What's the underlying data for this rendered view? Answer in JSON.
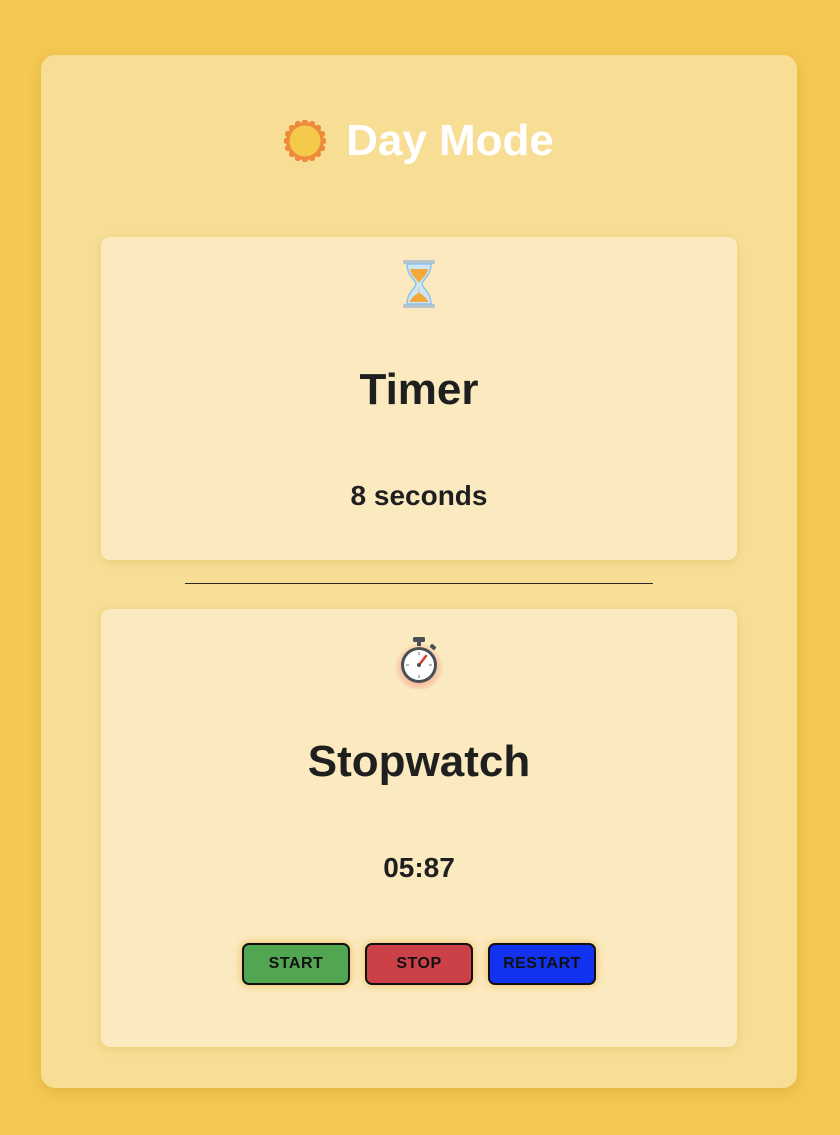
{
  "header": {
    "icon": "sun-icon",
    "title": "Day Mode"
  },
  "timer": {
    "icon": "hourglass-icon",
    "title": "Timer",
    "value": "8 seconds"
  },
  "stopwatch": {
    "icon": "stopwatch-icon",
    "title": "Stopwatch",
    "value": "05:87",
    "buttons": {
      "start": "START",
      "stop": "STOP",
      "restart": "RESTART"
    }
  },
  "colors": {
    "page_background": "#f4c853",
    "card_background": "#f7de94",
    "panel_background": "#fbeac0",
    "start_button": "#52a651",
    "stop_button": "#cc4048",
    "restart_button": "#1232f0",
    "title_text": "#ffffff"
  }
}
